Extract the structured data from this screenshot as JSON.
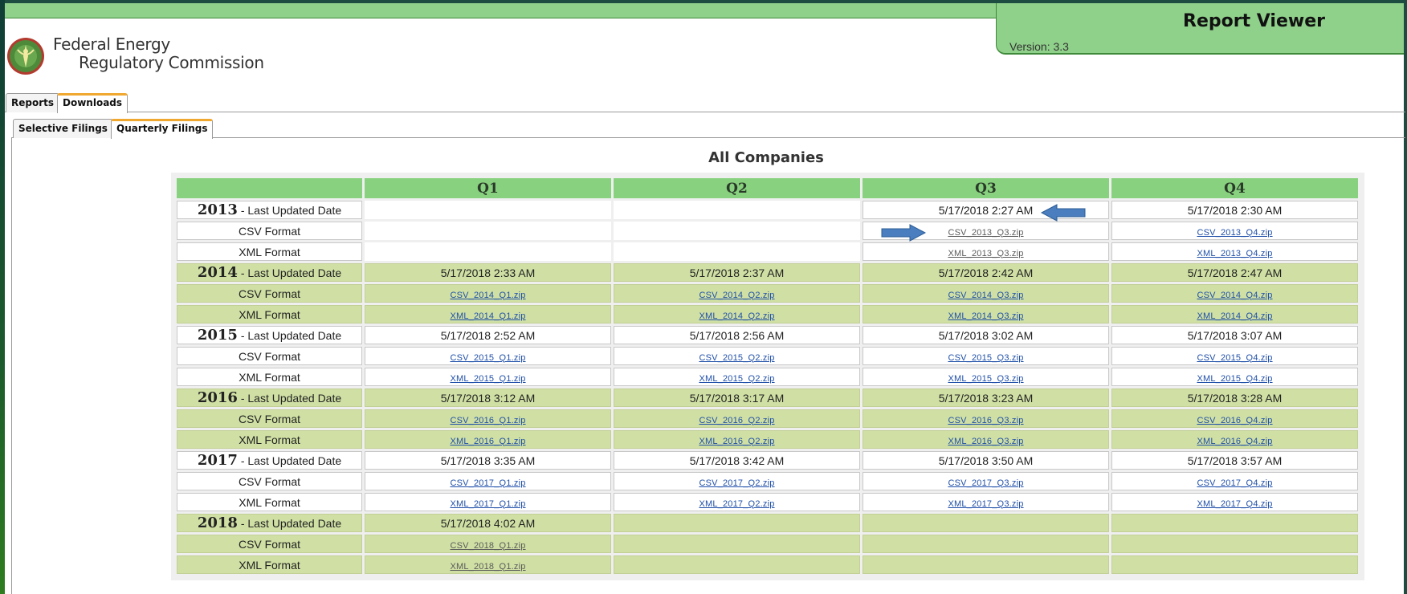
{
  "header": {
    "app_title": "Report Viewer",
    "version": "Version: 3.3",
    "org_line1": "Federal Energy",
    "org_line2": "Regulatory Commission"
  },
  "tabs": {
    "primary": [
      {
        "label": "Reports",
        "active": false
      },
      {
        "label": "Downloads",
        "active": true
      }
    ],
    "secondary": [
      {
        "label": "Selective Filings",
        "active": false
      },
      {
        "label": "Quarterly Filings",
        "active": true
      }
    ]
  },
  "page": {
    "heading": "All Companies"
  },
  "table": {
    "columns": [
      "Q1",
      "Q2",
      "Q3",
      "Q4"
    ],
    "updated_label": "- Last Updated Date",
    "csv_label": "CSV Format",
    "xml_label": "XML Format",
    "years": [
      {
        "year": "2013",
        "dates": [
          "",
          "",
          "5/17/2018 2:27 AM",
          "5/17/2018 2:30 AM"
        ],
        "csv": [
          "",
          "",
          "CSV_2013_Q3.zip",
          "CSV_2013_Q4.zip"
        ],
        "xml": [
          "",
          "",
          "XML_2013_Q3.zip",
          "XML_2013_Q4.zip"
        ]
      },
      {
        "year": "2014",
        "dates": [
          "5/17/2018 2:33 AM",
          "5/17/2018 2:37 AM",
          "5/17/2018 2:42 AM",
          "5/17/2018 2:47 AM"
        ],
        "csv": [
          "CSV_2014_Q1.zip",
          "CSV_2014_Q2.zip",
          "CSV_2014_Q3.zip",
          "CSV_2014_Q4.zip"
        ],
        "xml": [
          "XML_2014_Q1.zip",
          "XML_2014_Q2.zip",
          "XML_2014_Q3.zip",
          "XML_2014_Q4.zip"
        ]
      },
      {
        "year": "2015",
        "dates": [
          "5/17/2018 2:52 AM",
          "5/17/2018 2:56 AM",
          "5/17/2018 3:02 AM",
          "5/17/2018 3:07 AM"
        ],
        "csv": [
          "CSV_2015_Q1.zip",
          "CSV_2015_Q2.zip",
          "CSV_2015_Q3.zip",
          "CSV_2015_Q4.zip"
        ],
        "xml": [
          "XML_2015_Q1.zip",
          "XML_2015_Q2.zip",
          "XML_2015_Q3.zip",
          "XML_2015_Q4.zip"
        ]
      },
      {
        "year": "2016",
        "dates": [
          "5/17/2018 3:12 AM",
          "5/17/2018 3:17 AM",
          "5/17/2018 3:23 AM",
          "5/17/2018 3:28 AM"
        ],
        "csv": [
          "CSV_2016_Q1.zip",
          "CSV_2016_Q2.zip",
          "CSV_2016_Q3.zip",
          "CSV_2016_Q4.zip"
        ],
        "xml": [
          "XML_2016_Q1.zip",
          "XML_2016_Q2.zip",
          "XML_2016_Q3.zip",
          "XML_2016_Q4.zip"
        ]
      },
      {
        "year": "2017",
        "dates": [
          "5/17/2018 3:35 AM",
          "5/17/2018 3:42 AM",
          "5/17/2018 3:50 AM",
          "5/17/2018 3:57 AM"
        ],
        "csv": [
          "CSV_2017_Q1.zip",
          "CSV_2017_Q2.zip",
          "CSV_2017_Q3.zip",
          "CSV_2017_Q4.zip"
        ],
        "xml": [
          "XML_2017_Q1.zip",
          "XML_2017_Q2.zip",
          "XML_2017_Q3.zip",
          "XML_2017_Q4.zip"
        ]
      },
      {
        "year": "2018",
        "dates": [
          "5/17/2018 4:02 AM",
          "",
          "",
          ""
        ],
        "csv": [
          "CSV_2018_Q1.zip",
          "",
          "",
          ""
        ],
        "xml": [
          "XML_2018_Q1.zip",
          "",
          "",
          ""
        ]
      }
    ]
  },
  "annotations": {
    "arrow_color": "#4a7ebf",
    "arrows": [
      "left-arrow-icon at 2013 Q3 date",
      "right-arrow-icon at 2013 Q3 CSV link"
    ]
  },
  "colors": {
    "header_green": "#8fd08a",
    "column_header_green": "#88d17e",
    "row_green": "#d0e0a4",
    "tab_accent": "#f0a830",
    "link_blue": "#1f4fa8"
  }
}
